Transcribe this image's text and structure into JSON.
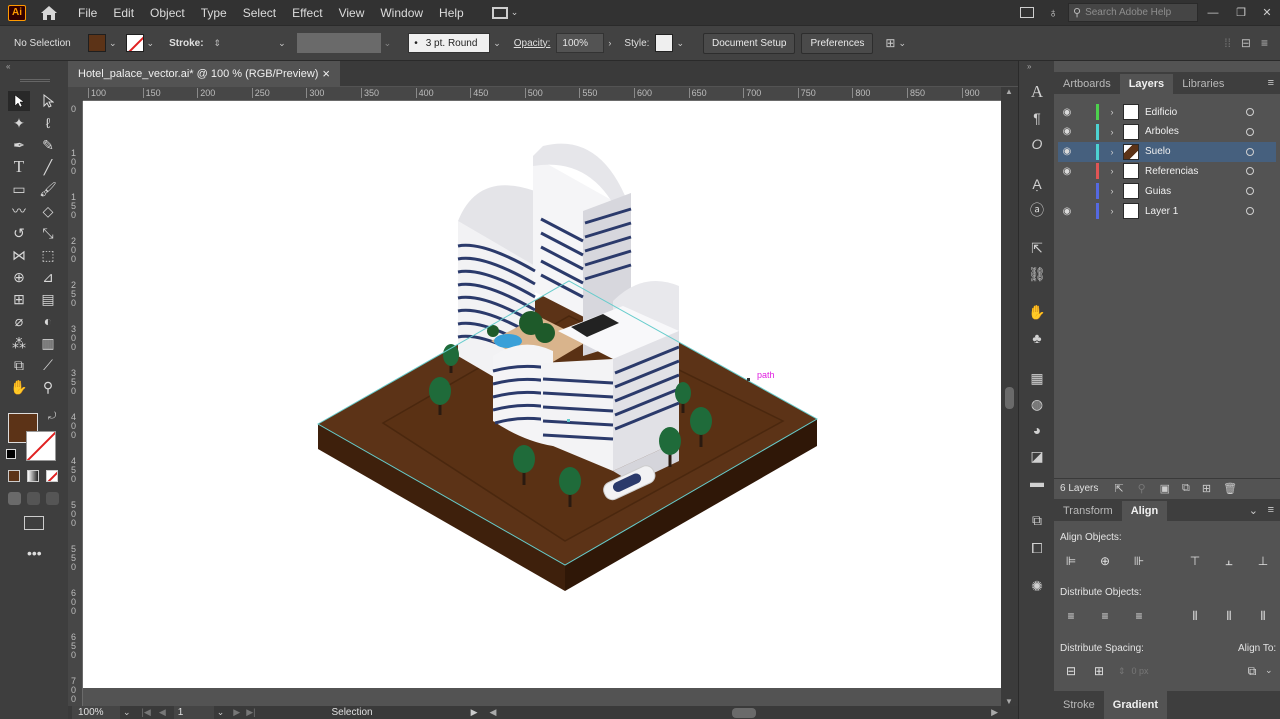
{
  "app": {
    "logo": "Ai",
    "icons": [
      "home-icon",
      "workspace-grid-icon",
      "arrange-icon",
      "lightbulb-icon"
    ]
  },
  "menu": [
    "File",
    "Edit",
    "Object",
    "Type",
    "Select",
    "Effect",
    "View",
    "Window",
    "Help"
  ],
  "search": {
    "placeholder": "Search Adobe Help"
  },
  "control": {
    "selection": "No Selection",
    "fill_color": "#5c3317",
    "stroke_label": "Stroke:",
    "brush": "3 pt. Round",
    "opacity_label": "Opacity:",
    "opacity_value": "100%",
    "style_label": "Style:",
    "doc_setup": "Document Setup",
    "preferences": "Preferences"
  },
  "document": {
    "tab_title": "Hotel_palace_vector.ai* @ 100 % (RGB/Preview)",
    "close": "×",
    "ruler_h": [
      "100",
      "150",
      "200",
      "250",
      "300",
      "350",
      "400",
      "450",
      "500",
      "550",
      "600",
      "650",
      "700",
      "750",
      "800",
      "850",
      "900"
    ],
    "ruler_v": [
      "0",
      "1\n0\n0",
      "1\n5\n0",
      "2\n0\n0",
      "2\n5\n0",
      "3\n0\n0",
      "3\n5\n0",
      "4\n0\n0",
      "4\n5\n0",
      "5\n0\n0",
      "5\n5\n0",
      "6\n0\n0",
      "6\n5\n0",
      "7\n0\n0"
    ],
    "path_label": "path"
  },
  "status": {
    "zoom": "100%",
    "artboard": "1",
    "tool": "Selection"
  },
  "panels": {
    "tabs": [
      "Artboards",
      "Layers",
      "Libraries"
    ],
    "active_tab": "Layers",
    "layers": [
      {
        "name": "Edificio",
        "color": "#4dd14d",
        "visible": true,
        "selected": false
      },
      {
        "name": "Arboles",
        "color": "#4dd2d2",
        "visible": true,
        "selected": false
      },
      {
        "name": "Suelo",
        "color": "#4dd2d2",
        "visible": true,
        "selected": true
      },
      {
        "name": "Referencias",
        "color": "#e05555",
        "visible": true,
        "selected": false
      },
      {
        "name": "Guias",
        "color": "#5569e0",
        "visible": false,
        "selected": false
      },
      {
        "name": "Layer 1",
        "color": "#5569e0",
        "visible": true,
        "selected": false
      }
    ],
    "layers_count": "6 Layers",
    "align_tabs": [
      "Transform",
      "Align"
    ],
    "align_active": "Align",
    "align_objects": "Align Objects:",
    "distribute_objects": "Distribute Objects:",
    "distribute_spacing": "Distribute Spacing:",
    "align_to": "Align To:",
    "spacing_value": "0 px",
    "bottom_tabs": [
      "Stroke",
      "Gradient"
    ],
    "bottom_active": "Gradient"
  },
  "colors": {
    "soil_top": "#5c3317",
    "soil_side": "#3e200c",
    "building_stripe": "#2b3a6b",
    "selection": "#66cccc"
  }
}
